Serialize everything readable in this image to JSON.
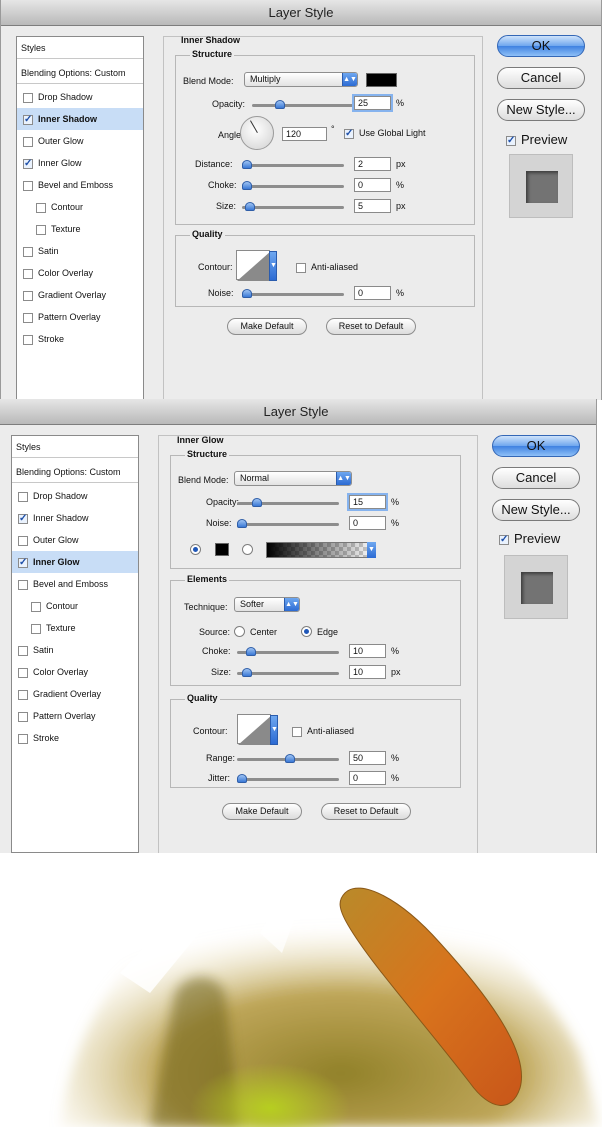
{
  "window1": {
    "title": "Layer Style",
    "styles_header": "Styles",
    "blending_options": "Blending Options: Custom",
    "effects": [
      {
        "label": "Drop Shadow",
        "checked": false
      },
      {
        "label": "Inner Shadow",
        "checked": true,
        "selected": true
      },
      {
        "label": "Outer Glow",
        "checked": false
      },
      {
        "label": "Inner Glow",
        "checked": true
      },
      {
        "label": "Bevel and Emboss",
        "checked": false
      },
      {
        "label": "Contour",
        "checked": false,
        "indent": true
      },
      {
        "label": "Texture",
        "checked": false,
        "indent": true
      },
      {
        "label": "Satin",
        "checked": false
      },
      {
        "label": "Color Overlay",
        "checked": false
      },
      {
        "label": "Gradient Overlay",
        "checked": false
      },
      {
        "label": "Pattern Overlay",
        "checked": false
      },
      {
        "label": "Stroke",
        "checked": false
      }
    ],
    "panel_title": "Inner Shadow",
    "structure_title": "Structure",
    "blend_mode_label": "Blend Mode:",
    "blend_mode_value": "Multiply",
    "shadow_color": "#000000",
    "opacity_label": "Opacity:",
    "opacity_value": "25",
    "percent": "%",
    "px": "px",
    "angle_label": "Angle:",
    "angle_value": "120",
    "degree": "°",
    "use_global_light": "Use Global Light",
    "use_global_light_checked": true,
    "distance_label": "Distance:",
    "distance_value": "2",
    "choke_label": "Choke:",
    "choke_value": "0",
    "size_label": "Size:",
    "size_value": "5",
    "quality_title": "Quality",
    "contour_label": "Contour:",
    "anti_aliased": "Anti-aliased",
    "anti_aliased_checked": false,
    "noise_label": "Noise:",
    "noise_value": "0",
    "make_default": "Make Default",
    "reset_to_default": "Reset to Default",
    "ok": "OK",
    "cancel": "Cancel",
    "new_style": "New Style...",
    "preview": "Preview",
    "preview_checked": true
  },
  "window2": {
    "title": "Layer Style",
    "styles_header": "Styles",
    "blending_options": "Blending Options: Custom",
    "effects": [
      {
        "label": "Drop Shadow",
        "checked": false
      },
      {
        "label": "Inner Shadow",
        "checked": true
      },
      {
        "label": "Outer Glow",
        "checked": false
      },
      {
        "label": "Inner Glow",
        "checked": true,
        "selected": true
      },
      {
        "label": "Bevel and Emboss",
        "checked": false
      },
      {
        "label": "Contour",
        "checked": false,
        "indent": true
      },
      {
        "label": "Texture",
        "checked": false,
        "indent": true
      },
      {
        "label": "Satin",
        "checked": false
      },
      {
        "label": "Color Overlay",
        "checked": false
      },
      {
        "label": "Gradient Overlay",
        "checked": false
      },
      {
        "label": "Pattern Overlay",
        "checked": false
      },
      {
        "label": "Stroke",
        "checked": false
      }
    ],
    "panel_title": "Inner Glow",
    "structure_title": "Structure",
    "blend_mode_label": "Blend Mode:",
    "blend_mode_value": "Normal",
    "opacity_label": "Opacity:",
    "opacity_value": "15",
    "noise_label": "Noise:",
    "noise_value": "0",
    "percent": "%",
    "px": "px",
    "glow_color": "#000000",
    "elements_title": "Elements",
    "technique_label": "Technique:",
    "technique_value": "Softer",
    "source_label": "Source:",
    "source_center": "Center",
    "source_edge": "Edge",
    "source_selected": "Edge",
    "choke_label": "Choke:",
    "choke_value": "10",
    "size_label": "Size:",
    "size_value": "10",
    "quality_title": "Quality",
    "contour_label": "Contour:",
    "anti_aliased": "Anti-aliased",
    "anti_aliased_checked": false,
    "range_label": "Range:",
    "range_value": "50",
    "jitter_label": "Jitter:",
    "jitter_value": "0",
    "make_default": "Make Default",
    "reset_to_default": "Reset to Default",
    "ok": "OK",
    "cancel": "Cancel",
    "new_style": "New Style...",
    "preview": "Preview",
    "preview_checked": true
  },
  "artwork": {
    "colors": {
      "ochre": "#a8871e",
      "orange": "#d8731c",
      "green": "#a8c020"
    }
  },
  "icons": {
    "check": "✓",
    "dropdown": "▲▼"
  }
}
